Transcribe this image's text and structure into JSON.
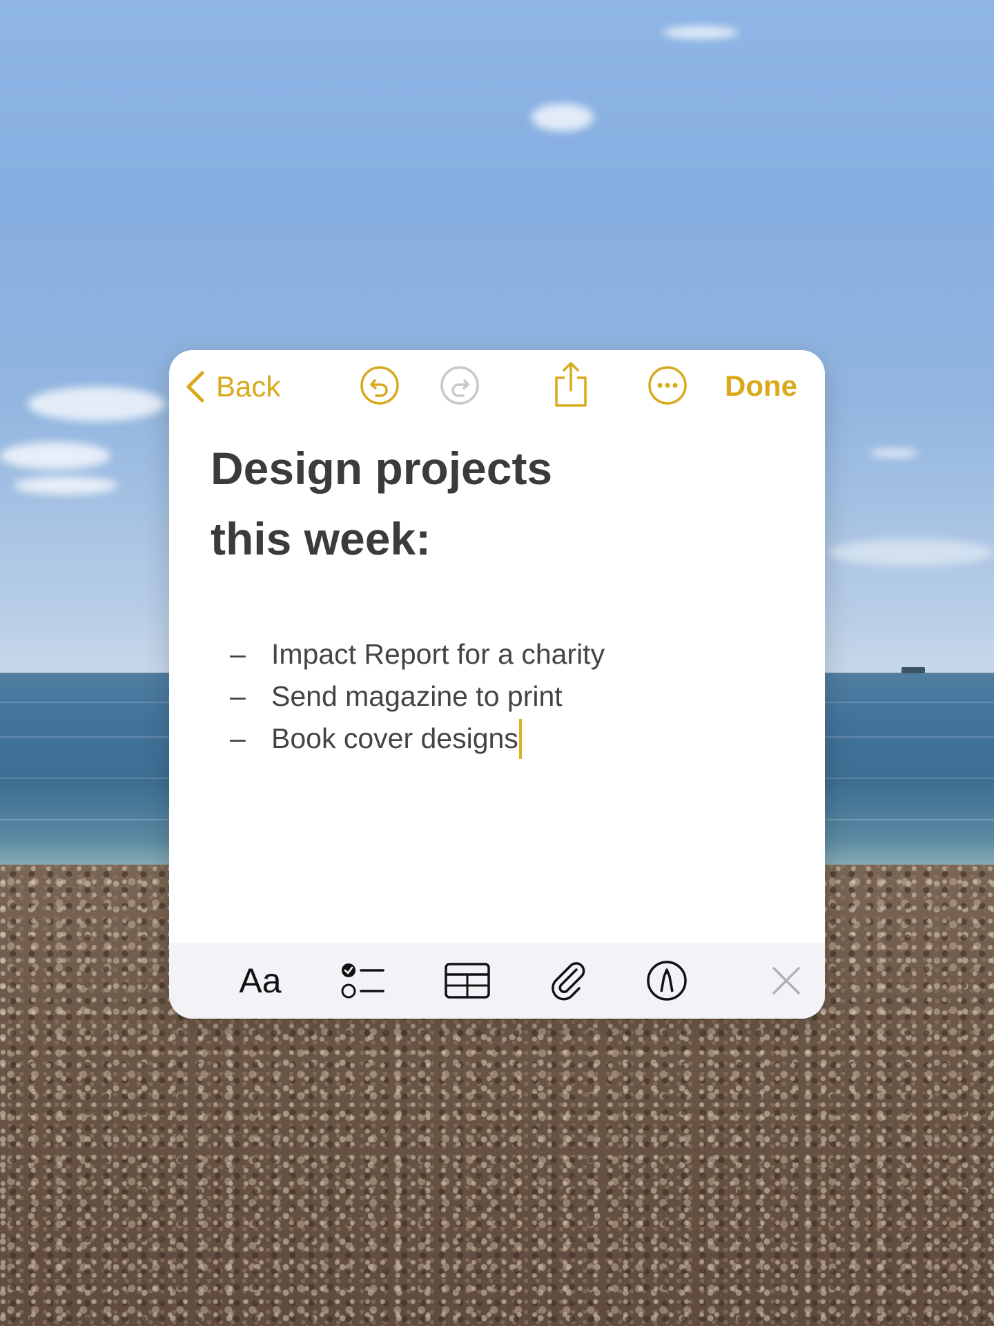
{
  "nav": {
    "back_label": "Back",
    "done_label": "Done",
    "undo_icon": "undo-icon",
    "redo_icon": "redo-icon",
    "share_icon": "share-icon",
    "more_icon": "ellipsis-circle-icon",
    "accent_color": "#d9a91a",
    "disabled_color": "#c7c7cc"
  },
  "note": {
    "title": "Design projects this week:",
    "items": [
      {
        "bullet": "–",
        "text": "Impact Report for a charity"
      },
      {
        "bullet": "–",
        "text": "Send magazine to print"
      },
      {
        "bullet": "–",
        "text": "Book cover designs"
      }
    ]
  },
  "toolbar": {
    "format_label": "Aa",
    "checklist_icon": "checklist-icon",
    "table_icon": "table-icon",
    "attachment_icon": "paperclip-icon",
    "markup_icon": "markup-pen-icon",
    "close_icon": "close-icon"
  }
}
